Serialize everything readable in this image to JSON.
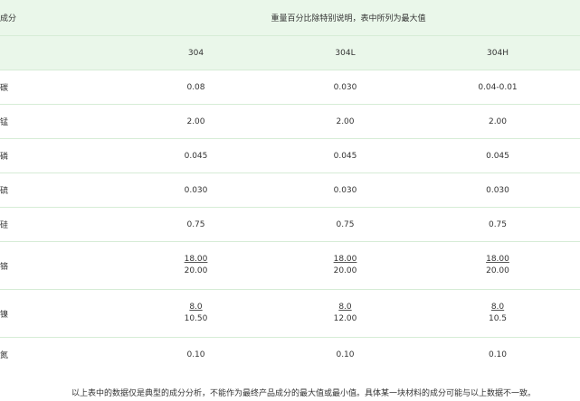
{
  "header": {
    "component_label": "成分",
    "title": "重量百分比除特别说明，表中所列为最大值"
  },
  "grades": [
    "304",
    "304L",
    "304H"
  ],
  "rows": [
    {
      "element": "碳",
      "values": [
        [
          "0.08"
        ],
        [
          "0.030"
        ],
        [
          "0.04-0.01"
        ]
      ]
    },
    {
      "element": "锰",
      "values": [
        [
          "2.00"
        ],
        [
          "2.00"
        ],
        [
          "2.00"
        ]
      ]
    },
    {
      "element": "磷",
      "values": [
        [
          "0.045"
        ],
        [
          "0.045"
        ],
        [
          "0.045"
        ]
      ]
    },
    {
      "element": "硫",
      "values": [
        [
          "0.030"
        ],
        [
          "0.030"
        ],
        [
          "0.030"
        ]
      ]
    },
    {
      "element": "硅",
      "values": [
        [
          "0.75"
        ],
        [
          "0.75"
        ],
        [
          "0.75"
        ]
      ]
    },
    {
      "element": "铬",
      "values": [
        [
          "18.00",
          "20.00"
        ],
        [
          "18.00",
          "20.00"
        ],
        [
          "18.00",
          "20.00"
        ]
      ]
    },
    {
      "element": "镍",
      "values": [
        [
          "8.0",
          "10.50"
        ],
        [
          "8.0",
          "12.00"
        ],
        [
          "8.0",
          "10.5"
        ]
      ]
    },
    {
      "element": "氮",
      "values": [
        [
          "0.10"
        ],
        [
          "0.10"
        ],
        [
          "0.10"
        ]
      ]
    }
  ],
  "footnote": "以上表中的数据仅是典型的成分分析，不能作为最终产品成分的最大值或最小值。具体某一块材料的成分可能与以上数据不一致。"
}
